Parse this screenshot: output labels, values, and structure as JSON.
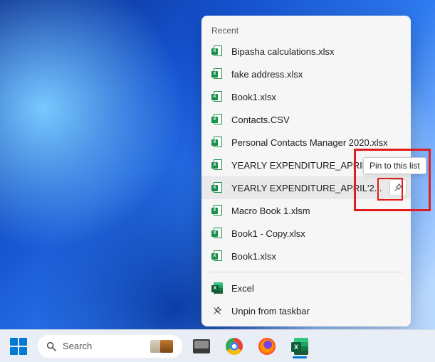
{
  "jumplist": {
    "section_header": "Recent",
    "items": [
      {
        "label": "Bipasha calculations.xlsx"
      },
      {
        "label": "fake address.xlsx"
      },
      {
        "label": "Book1.xlsx"
      },
      {
        "label": "Contacts.CSV"
      },
      {
        "label": "Personal Contacts Manager 2020.xlsx"
      },
      {
        "label": "YEARLY EXPENDITURE_APRIL'2..."
      },
      {
        "label": "YEARLY EXPENDITURE_APRIL'2..."
      },
      {
        "label": "Macro Book 1.xlsm"
      },
      {
        "label": "Book1 - Copy.xlsx"
      },
      {
        "label": "Book1.xlsx"
      }
    ],
    "app_label": "Excel",
    "unpin_label": "Unpin from taskbar"
  },
  "tooltip_pin": "Pin to this list",
  "taskbar": {
    "search_placeholder": "Search"
  }
}
